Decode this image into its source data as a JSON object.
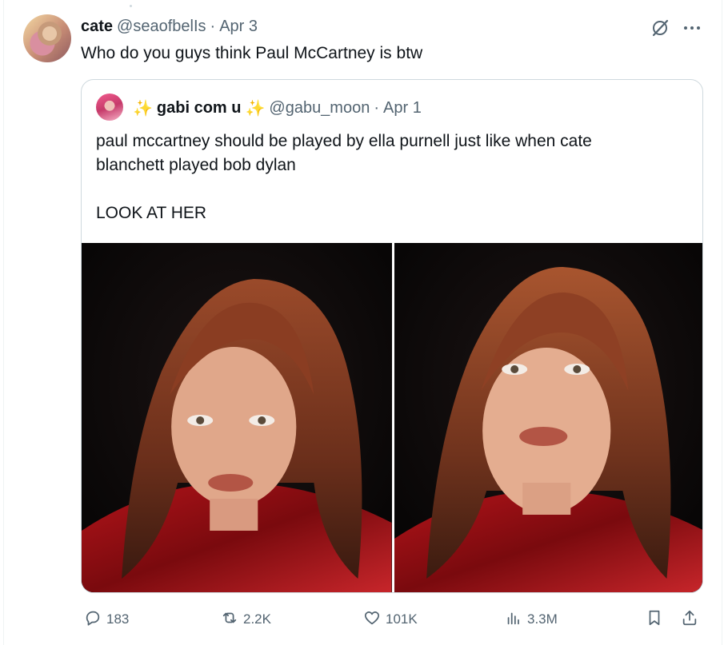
{
  "post": {
    "author_name": "cate",
    "author_handle": "@seaofbelIs",
    "separator": "·",
    "date": "Apr 3",
    "text": "Who do you guys think Paul McCartney is btw"
  },
  "quote": {
    "sparkle_left": "✨",
    "author_name": "gabi com u",
    "sparkle_right": "✨",
    "author_handle": "@gabu_moon",
    "separator": "·",
    "date": "Apr 1",
    "text_line1": "paul mccartney should be played by ella purnell just like when cate",
    "text_line2": "blanchett played bob dylan",
    "text_line3": "LOOK AT HER",
    "images": [
      {
        "name": "photo-1"
      },
      {
        "name": "photo-2"
      }
    ]
  },
  "actions": {
    "replies": "183",
    "reposts": "2.2K",
    "likes": "101K",
    "views": "3.3M"
  },
  "icons": {
    "grok": "grok-icon",
    "more": "more-options-icon",
    "reply": "reply-icon",
    "repost": "repost-icon",
    "like": "heart-icon",
    "views": "views-chart-icon",
    "bookmark": "bookmark-icon",
    "share": "share-icon"
  },
  "colors": {
    "text_primary": "#0f1419",
    "text_secondary": "#536471",
    "border": "#cfd9de",
    "sparkle": "#f5c518"
  }
}
